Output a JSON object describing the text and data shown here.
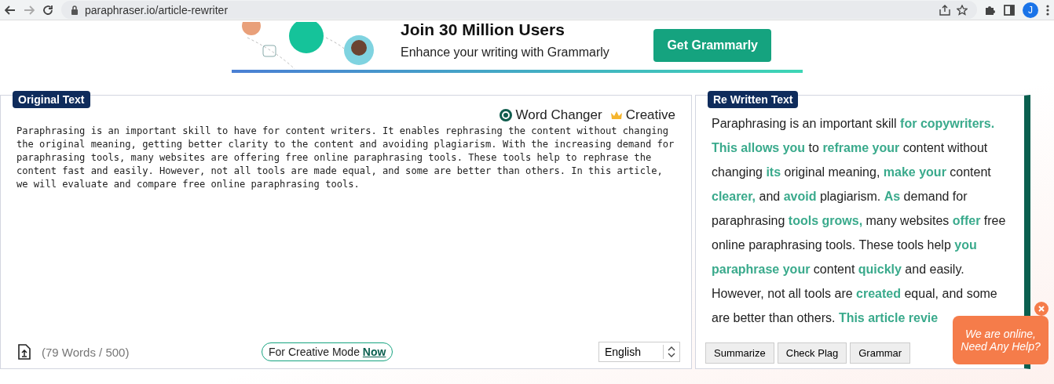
{
  "browser": {
    "url": "paraphraser.io/article-rewriter",
    "profile": "J"
  },
  "ad": {
    "headline": "Join 30 Million Users",
    "subline": "Enhance your writing with Grammarly",
    "button": "Get Grammarly"
  },
  "original": {
    "label": "Original Text",
    "modes": [
      {
        "label": "Word Changer",
        "selected": true,
        "kind": "radio"
      },
      {
        "label": "Creative",
        "selected": false,
        "kind": "premium"
      }
    ],
    "text": "Paraphrasing is an important skill to have for content writers. It enables rephrasing the content without changing the original meaning, getting better clarity to the content and avoiding plagiarism. With the increasing demand for paraphrasing tools, many websites are offering free online paraphrasing tools. These tools help to rephrase the content fast and easily. However, not all tools are made equal, and some are better than others. In this article, we will evaluate and compare free online paraphrasing tools.",
    "word_count": "(79 Words / 500)",
    "promo": "For Creative Mode **Now**",
    "language": "English"
  },
  "rewritten": {
    "label": "Re Written Text",
    "segments": [
      {
        "text": "Paraphrasing is an important skill ",
        "changed": false
      },
      {
        "text": "for copywriters. This allows you",
        "changed": true
      },
      {
        "text": " to ",
        "changed": false
      },
      {
        "text": "reframe your",
        "changed": true
      },
      {
        "text": " content without changing ",
        "changed": false
      },
      {
        "text": "its",
        "changed": true
      },
      {
        "text": " original meaning, ",
        "changed": false
      },
      {
        "text": "make your",
        "changed": true
      },
      {
        "text": " content ",
        "changed": false
      },
      {
        "text": "clearer,",
        "changed": true
      },
      {
        "text": " and ",
        "changed": false
      },
      {
        "text": "avoid",
        "changed": true
      },
      {
        "text": " plagiarism. ",
        "changed": false
      },
      {
        "text": "As",
        "changed": true
      },
      {
        "text": " demand for paraphrasing ",
        "changed": false
      },
      {
        "text": "tools grows,",
        "changed": true
      },
      {
        "text": " many websites ",
        "changed": false
      },
      {
        "text": "offer",
        "changed": true
      },
      {
        "text": " free online paraphrasing tools. These tools help ",
        "changed": false
      },
      {
        "text": "you paraphrase your",
        "changed": true
      },
      {
        "text": " content ",
        "changed": false
      },
      {
        "text": "quickly",
        "changed": true
      },
      {
        "text": " and easily. However, not all tools are ",
        "changed": false
      },
      {
        "text": "created",
        "changed": true
      },
      {
        "text": " equal, and some are better than others. ",
        "changed": false
      },
      {
        "text": "This article revie",
        "changed": true
      }
    ],
    "actions": [
      "Summarize",
      "Check Plag",
      "Grammar"
    ]
  },
  "chat": {
    "text": "We are online, Need Any Help?"
  }
}
